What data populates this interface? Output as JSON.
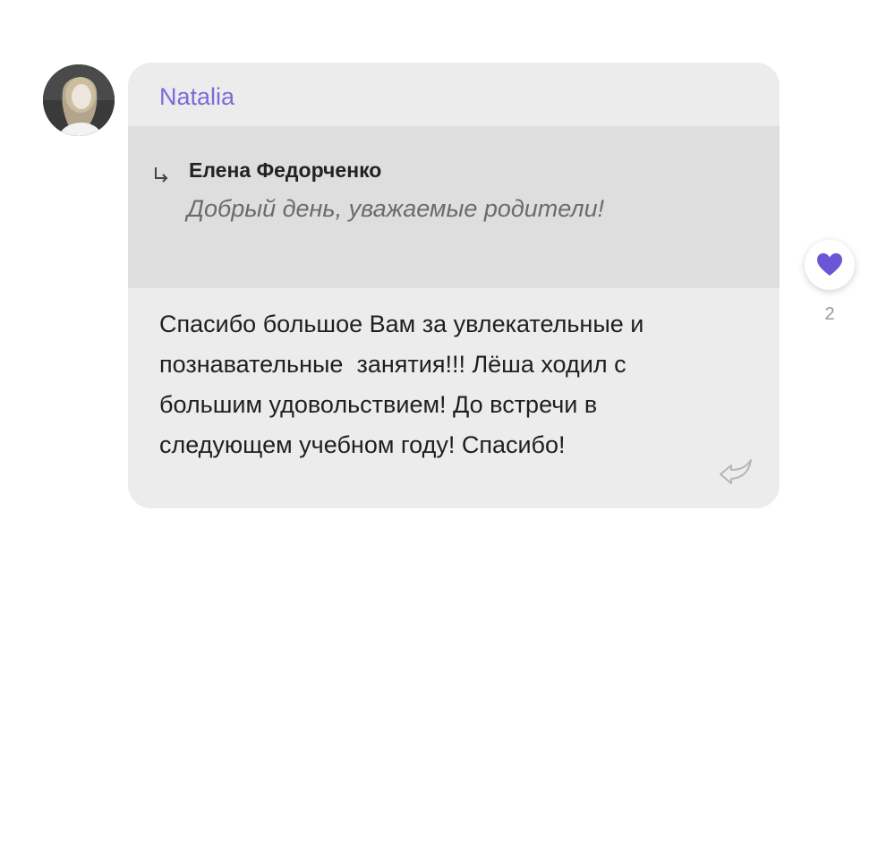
{
  "message": {
    "sender_name": "Natalia",
    "quoted": {
      "author": "Елена Федорченко",
      "text": "Добрый день, уважаемые родители!"
    },
    "body": "Спасибо большое Вам за увлекательные и познавательные  занятия!!! Лёша ходил с большим удовольствием! До встречи в следующем учебном году! Спасибо!",
    "reaction": {
      "icon": "heart-icon",
      "count": "2",
      "color": "#6c56d6"
    },
    "reply_icon": "reply-icon",
    "avatar_icon": "avatar-photo"
  },
  "colors": {
    "accent": "#7b6bd8",
    "bubble": "#ececec",
    "quote_bg": "#dedede"
  }
}
